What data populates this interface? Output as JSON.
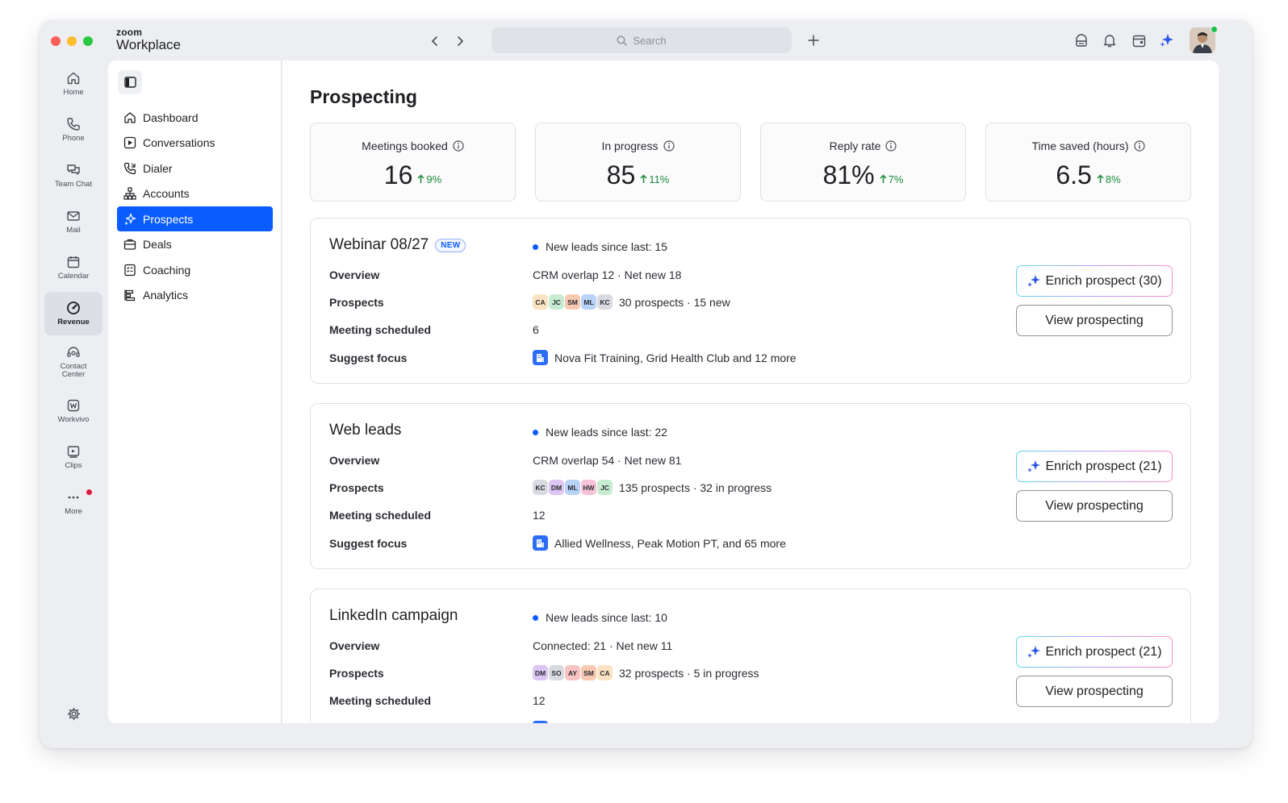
{
  "app": {
    "brand_small": "zoom",
    "brand_big": "Workplace"
  },
  "search": {
    "placeholder": "Search"
  },
  "rail": {
    "items": [
      {
        "label": "Home"
      },
      {
        "label": "Phone"
      },
      {
        "label": "Team Chat"
      },
      {
        "label": "Mail"
      },
      {
        "label": "Calendar"
      },
      {
        "label": "Revenue"
      },
      {
        "label": "Contact Center"
      },
      {
        "label": "Workvivo"
      },
      {
        "label": "Clips"
      },
      {
        "label": "More"
      }
    ]
  },
  "nav": {
    "items": [
      {
        "label": "Dashboard"
      },
      {
        "label": "Conversations"
      },
      {
        "label": "Dialer"
      },
      {
        "label": "Accounts"
      },
      {
        "label": "Prospects"
      },
      {
        "label": "Deals"
      },
      {
        "label": "Coaching"
      },
      {
        "label": "Analytics"
      }
    ]
  },
  "page": {
    "title": "Prospecting"
  },
  "stats": [
    {
      "label": "Meetings booked",
      "value": "16",
      "delta": "9%"
    },
    {
      "label": "In progress",
      "value": "85",
      "delta": "11%"
    },
    {
      "label": "Reply rate",
      "value": "81%",
      "delta": "7%"
    },
    {
      "label": "Time saved (hours)",
      "value": "6.5",
      "delta": "8%"
    }
  ],
  "labels": {
    "overview": "Overview",
    "prospects": "Prospects",
    "meeting_scheduled": "Meeting scheduled",
    "suggest_focus": "Suggest focus",
    "view_prospecting": "View prospecting",
    "new_badge": "NEW"
  },
  "colors": {
    "accent": "#0b5cff",
    "positive": "#1a8a3a"
  },
  "campaigns": [
    {
      "title": "Webinar 08/27",
      "new_leads": "New leads since last: 15",
      "overview": "CRM overlap 12 · Net new 18",
      "chips": [
        "CA",
        "JC",
        "SM",
        "ML",
        "KC"
      ],
      "prospects": "30 prospects · 15 new",
      "meeting_scheduled": "6",
      "suggest_focus": "Nova Fit Training, Grid Health Club and 12 more",
      "enrich_label": "Enrich prospect (30)"
    },
    {
      "title": "Web leads",
      "new_leads": "New leads since last: 22",
      "overview": "CRM overlap 54 · Net new 81",
      "chips": [
        "KC",
        "DM",
        "ML",
        "HW",
        "JC"
      ],
      "prospects": "135 prospects · 32 in progress",
      "meeting_scheduled": "12",
      "suggest_focus": "Allied Wellness, Peak Motion PT, and 65 more",
      "enrich_label": "Enrich prospect (21)"
    },
    {
      "title": "LinkedIn campaign",
      "new_leads": "New leads since last: 10",
      "overview": "Connected: 21 · Net new 11",
      "chips": [
        "DM",
        "SO",
        "AY",
        "SM",
        "CA"
      ],
      "prospects": "32 prospects · 5 in progress",
      "meeting_scheduled": "12",
      "suggest_focus": "",
      "enrich_label": "Enrich prospect (21)"
    }
  ]
}
